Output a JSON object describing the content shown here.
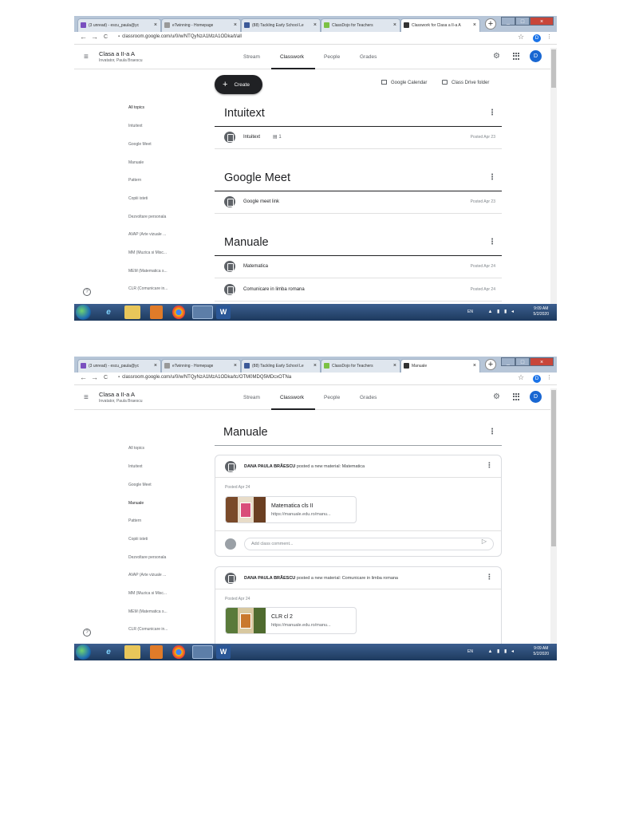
{
  "browser": {
    "tabs": [
      {
        "title": "(3 unread) - escu_paula@yc",
        "fav": "#7a4fbf",
        "close": "×"
      },
      {
        "title": "eTwinning - Homepage",
        "fav": "#999999",
        "close": "×"
      },
      {
        "title": "(88) Tackling Early School Le",
        "fav": "#3b5998",
        "close": "×"
      },
      {
        "title": "ClassDojo for Teachers",
        "fav": "#7bc143",
        "close": "×"
      },
      {
        "title": "Classwork for Clasa a II-a A",
        "fav": "#333333",
        "close": "×"
      }
    ],
    "shot2_active_tab_title": "Manuale",
    "url1": "classroom.google.com/u/0/w/NTQyNzA1MzA1ODka/t/all",
    "url2": "classroom.google.com/u/0/w/NTQyNzA1MzA1ODka/tc/OTM0MDQ5MDcxOTNa",
    "newtab": "+",
    "back": "←",
    "forward": "→",
    "reload": "C",
    "star": "☆",
    "profile": "D",
    "menu": "⋮",
    "win_min": "_",
    "win_max": "□",
    "win_close": "×"
  },
  "header": {
    "class_name": "Clasa a II-a A",
    "teacher": "Invatator, Paula Braescu",
    "tabs": [
      "Stream",
      "Classwork",
      "People",
      "Grades"
    ],
    "active_tab": "Classwork",
    "avatar": "D",
    "hamburger": "≡",
    "gear": "⚙"
  },
  "sidebar": {
    "items": [
      "All topics",
      "Intuitext",
      "Google Meet",
      "Manuale",
      "Pattern",
      "Copiii isteti",
      "Dezvoltare personala",
      "AVAP (Arte vizuale ...",
      "MM (Muzica si Misc...",
      "MEM (Matematica s...",
      "CLR (Comunicare in..."
    ],
    "help": "?"
  },
  "classwork": {
    "create_label": "Create",
    "create_plus": "+",
    "calendar_label": "Google Calendar",
    "drive_label": "Class Drive folder",
    "more": "⋮",
    "topics": [
      {
        "title": "Intuitext",
        "items": [
          {
            "title": "Intuitext",
            "comments": "1",
            "date": "Posted Apr 23"
          }
        ]
      },
      {
        "title": "Google Meet",
        "items": [
          {
            "title": "Google meet link",
            "date": "Posted Apr 23"
          }
        ]
      },
      {
        "title": "Manuale",
        "items": [
          {
            "title": "Matematica",
            "date": "Posted Apr 24"
          },
          {
            "title": "Comunicare in limba romana",
            "date": "Posted Apr 24"
          }
        ]
      }
    ]
  },
  "topic_page": {
    "title": "Manuale",
    "posts": [
      {
        "author": "DANA PAULA BRĂESCU",
        "action": "posted a new material:",
        "material": "Matematica",
        "date": "Posted Apr 24",
        "attachment_title": "Matematica cls II",
        "attachment_url": "https://manuale.edu.ro/manu...",
        "comment_placeholder": "Add class comment...",
        "send": "▷"
      },
      {
        "author": "DANA PAULA BRĂESCU",
        "action": "posted a new material:",
        "material": "Comunicare in limba romana",
        "date": "Posted Apr 24",
        "attachment_title": "CLR cl 2",
        "attachment_url": "https://manuale.edu.ro/manu..."
      }
    ]
  },
  "taskbar": {
    "word_label": "W",
    "lang": "EN",
    "tray_icons": "▲ ▮ ▮ ◂",
    "time": "9:09 AM",
    "date": "5/2/2020"
  },
  "colors": {
    "accent": "#1967d2",
    "tab_underline": "#202124",
    "create_button": "#202124"
  }
}
